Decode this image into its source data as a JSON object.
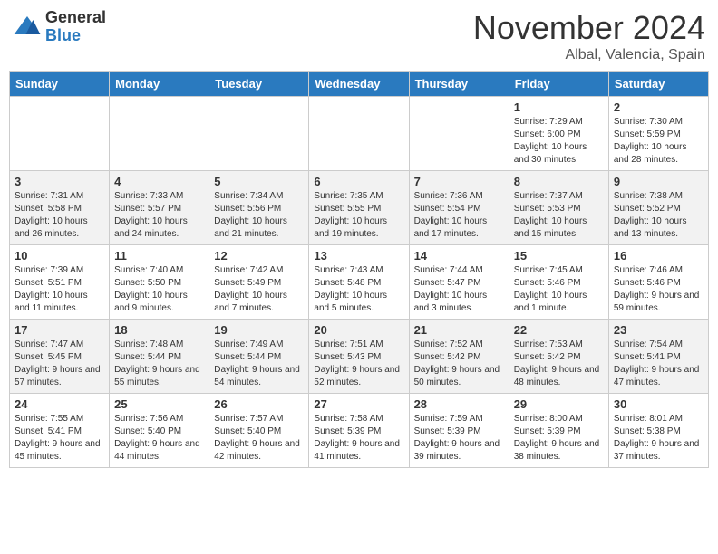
{
  "header": {
    "logo_general": "General",
    "logo_blue": "Blue",
    "month": "November 2024",
    "location": "Albal, Valencia, Spain"
  },
  "weekdays": [
    "Sunday",
    "Monday",
    "Tuesday",
    "Wednesday",
    "Thursday",
    "Friday",
    "Saturday"
  ],
  "weeks": [
    [
      {
        "day": "",
        "info": ""
      },
      {
        "day": "",
        "info": ""
      },
      {
        "day": "",
        "info": ""
      },
      {
        "day": "",
        "info": ""
      },
      {
        "day": "",
        "info": ""
      },
      {
        "day": "1",
        "info": "Sunrise: 7:29 AM\nSunset: 6:00 PM\nDaylight: 10 hours and 30 minutes."
      },
      {
        "day": "2",
        "info": "Sunrise: 7:30 AM\nSunset: 5:59 PM\nDaylight: 10 hours and 28 minutes."
      }
    ],
    [
      {
        "day": "3",
        "info": "Sunrise: 7:31 AM\nSunset: 5:58 PM\nDaylight: 10 hours and 26 minutes."
      },
      {
        "day": "4",
        "info": "Sunrise: 7:33 AM\nSunset: 5:57 PM\nDaylight: 10 hours and 24 minutes."
      },
      {
        "day": "5",
        "info": "Sunrise: 7:34 AM\nSunset: 5:56 PM\nDaylight: 10 hours and 21 minutes."
      },
      {
        "day": "6",
        "info": "Sunrise: 7:35 AM\nSunset: 5:55 PM\nDaylight: 10 hours and 19 minutes."
      },
      {
        "day": "7",
        "info": "Sunrise: 7:36 AM\nSunset: 5:54 PM\nDaylight: 10 hours and 17 minutes."
      },
      {
        "day": "8",
        "info": "Sunrise: 7:37 AM\nSunset: 5:53 PM\nDaylight: 10 hours and 15 minutes."
      },
      {
        "day": "9",
        "info": "Sunrise: 7:38 AM\nSunset: 5:52 PM\nDaylight: 10 hours and 13 minutes."
      }
    ],
    [
      {
        "day": "10",
        "info": "Sunrise: 7:39 AM\nSunset: 5:51 PM\nDaylight: 10 hours and 11 minutes."
      },
      {
        "day": "11",
        "info": "Sunrise: 7:40 AM\nSunset: 5:50 PM\nDaylight: 10 hours and 9 minutes."
      },
      {
        "day": "12",
        "info": "Sunrise: 7:42 AM\nSunset: 5:49 PM\nDaylight: 10 hours and 7 minutes."
      },
      {
        "day": "13",
        "info": "Sunrise: 7:43 AM\nSunset: 5:48 PM\nDaylight: 10 hours and 5 minutes."
      },
      {
        "day": "14",
        "info": "Sunrise: 7:44 AM\nSunset: 5:47 PM\nDaylight: 10 hours and 3 minutes."
      },
      {
        "day": "15",
        "info": "Sunrise: 7:45 AM\nSunset: 5:46 PM\nDaylight: 10 hours and 1 minute."
      },
      {
        "day": "16",
        "info": "Sunrise: 7:46 AM\nSunset: 5:46 PM\nDaylight: 9 hours and 59 minutes."
      }
    ],
    [
      {
        "day": "17",
        "info": "Sunrise: 7:47 AM\nSunset: 5:45 PM\nDaylight: 9 hours and 57 minutes."
      },
      {
        "day": "18",
        "info": "Sunrise: 7:48 AM\nSunset: 5:44 PM\nDaylight: 9 hours and 55 minutes."
      },
      {
        "day": "19",
        "info": "Sunrise: 7:49 AM\nSunset: 5:44 PM\nDaylight: 9 hours and 54 minutes."
      },
      {
        "day": "20",
        "info": "Sunrise: 7:51 AM\nSunset: 5:43 PM\nDaylight: 9 hours and 52 minutes."
      },
      {
        "day": "21",
        "info": "Sunrise: 7:52 AM\nSunset: 5:42 PM\nDaylight: 9 hours and 50 minutes."
      },
      {
        "day": "22",
        "info": "Sunrise: 7:53 AM\nSunset: 5:42 PM\nDaylight: 9 hours and 48 minutes."
      },
      {
        "day": "23",
        "info": "Sunrise: 7:54 AM\nSunset: 5:41 PM\nDaylight: 9 hours and 47 minutes."
      }
    ],
    [
      {
        "day": "24",
        "info": "Sunrise: 7:55 AM\nSunset: 5:41 PM\nDaylight: 9 hours and 45 minutes."
      },
      {
        "day": "25",
        "info": "Sunrise: 7:56 AM\nSunset: 5:40 PM\nDaylight: 9 hours and 44 minutes."
      },
      {
        "day": "26",
        "info": "Sunrise: 7:57 AM\nSunset: 5:40 PM\nDaylight: 9 hours and 42 minutes."
      },
      {
        "day": "27",
        "info": "Sunrise: 7:58 AM\nSunset: 5:39 PM\nDaylight: 9 hours and 41 minutes."
      },
      {
        "day": "28",
        "info": "Sunrise: 7:59 AM\nSunset: 5:39 PM\nDaylight: 9 hours and 39 minutes."
      },
      {
        "day": "29",
        "info": "Sunrise: 8:00 AM\nSunset: 5:39 PM\nDaylight: 9 hours and 38 minutes."
      },
      {
        "day": "30",
        "info": "Sunrise: 8:01 AM\nSunset: 5:38 PM\nDaylight: 9 hours and 37 minutes."
      }
    ]
  ]
}
